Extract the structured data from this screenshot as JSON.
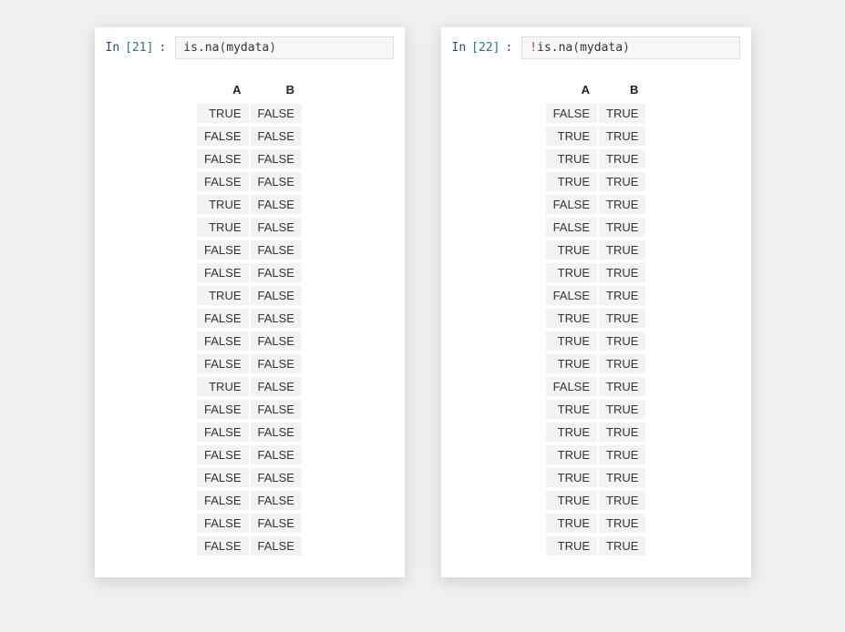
{
  "cells": [
    {
      "prompt_label": "In",
      "prompt_number": "[21]",
      "prompt_colon": ":",
      "code_prefix": "",
      "code_func": "is.na",
      "code_open": "(",
      "code_arg": "mydata",
      "code_close": ")",
      "headers": [
        "A",
        "B"
      ],
      "rows": [
        [
          "TRUE",
          "FALSE"
        ],
        [
          "FALSE",
          "FALSE"
        ],
        [
          "FALSE",
          "FALSE"
        ],
        [
          "FALSE",
          "FALSE"
        ],
        [
          "TRUE",
          "FALSE"
        ],
        [
          "TRUE",
          "FALSE"
        ],
        [
          "FALSE",
          "FALSE"
        ],
        [
          "FALSE",
          "FALSE"
        ],
        [
          "TRUE",
          "FALSE"
        ],
        [
          "FALSE",
          "FALSE"
        ],
        [
          "FALSE",
          "FALSE"
        ],
        [
          "FALSE",
          "FALSE"
        ],
        [
          "TRUE",
          "FALSE"
        ],
        [
          "FALSE",
          "FALSE"
        ],
        [
          "FALSE",
          "FALSE"
        ],
        [
          "FALSE",
          "FALSE"
        ],
        [
          "FALSE",
          "FALSE"
        ],
        [
          "FALSE",
          "FALSE"
        ],
        [
          "FALSE",
          "FALSE"
        ],
        [
          "FALSE",
          "FALSE"
        ]
      ]
    },
    {
      "prompt_label": "In",
      "prompt_number": "[22]",
      "prompt_colon": ":",
      "code_prefix": "!",
      "code_func": "is.na",
      "code_open": "(",
      "code_arg": "mydata",
      "code_close": ")",
      "headers": [
        "A",
        "B"
      ],
      "rows": [
        [
          "FALSE",
          "TRUE"
        ],
        [
          "TRUE",
          "TRUE"
        ],
        [
          "TRUE",
          "TRUE"
        ],
        [
          "TRUE",
          "TRUE"
        ],
        [
          "FALSE",
          "TRUE"
        ],
        [
          "FALSE",
          "TRUE"
        ],
        [
          "TRUE",
          "TRUE"
        ],
        [
          "TRUE",
          "TRUE"
        ],
        [
          "FALSE",
          "TRUE"
        ],
        [
          "TRUE",
          "TRUE"
        ],
        [
          "TRUE",
          "TRUE"
        ],
        [
          "TRUE",
          "TRUE"
        ],
        [
          "FALSE",
          "TRUE"
        ],
        [
          "TRUE",
          "TRUE"
        ],
        [
          "TRUE",
          "TRUE"
        ],
        [
          "TRUE",
          "TRUE"
        ],
        [
          "TRUE",
          "TRUE"
        ],
        [
          "TRUE",
          "TRUE"
        ],
        [
          "TRUE",
          "TRUE"
        ],
        [
          "TRUE",
          "TRUE"
        ]
      ]
    }
  ]
}
